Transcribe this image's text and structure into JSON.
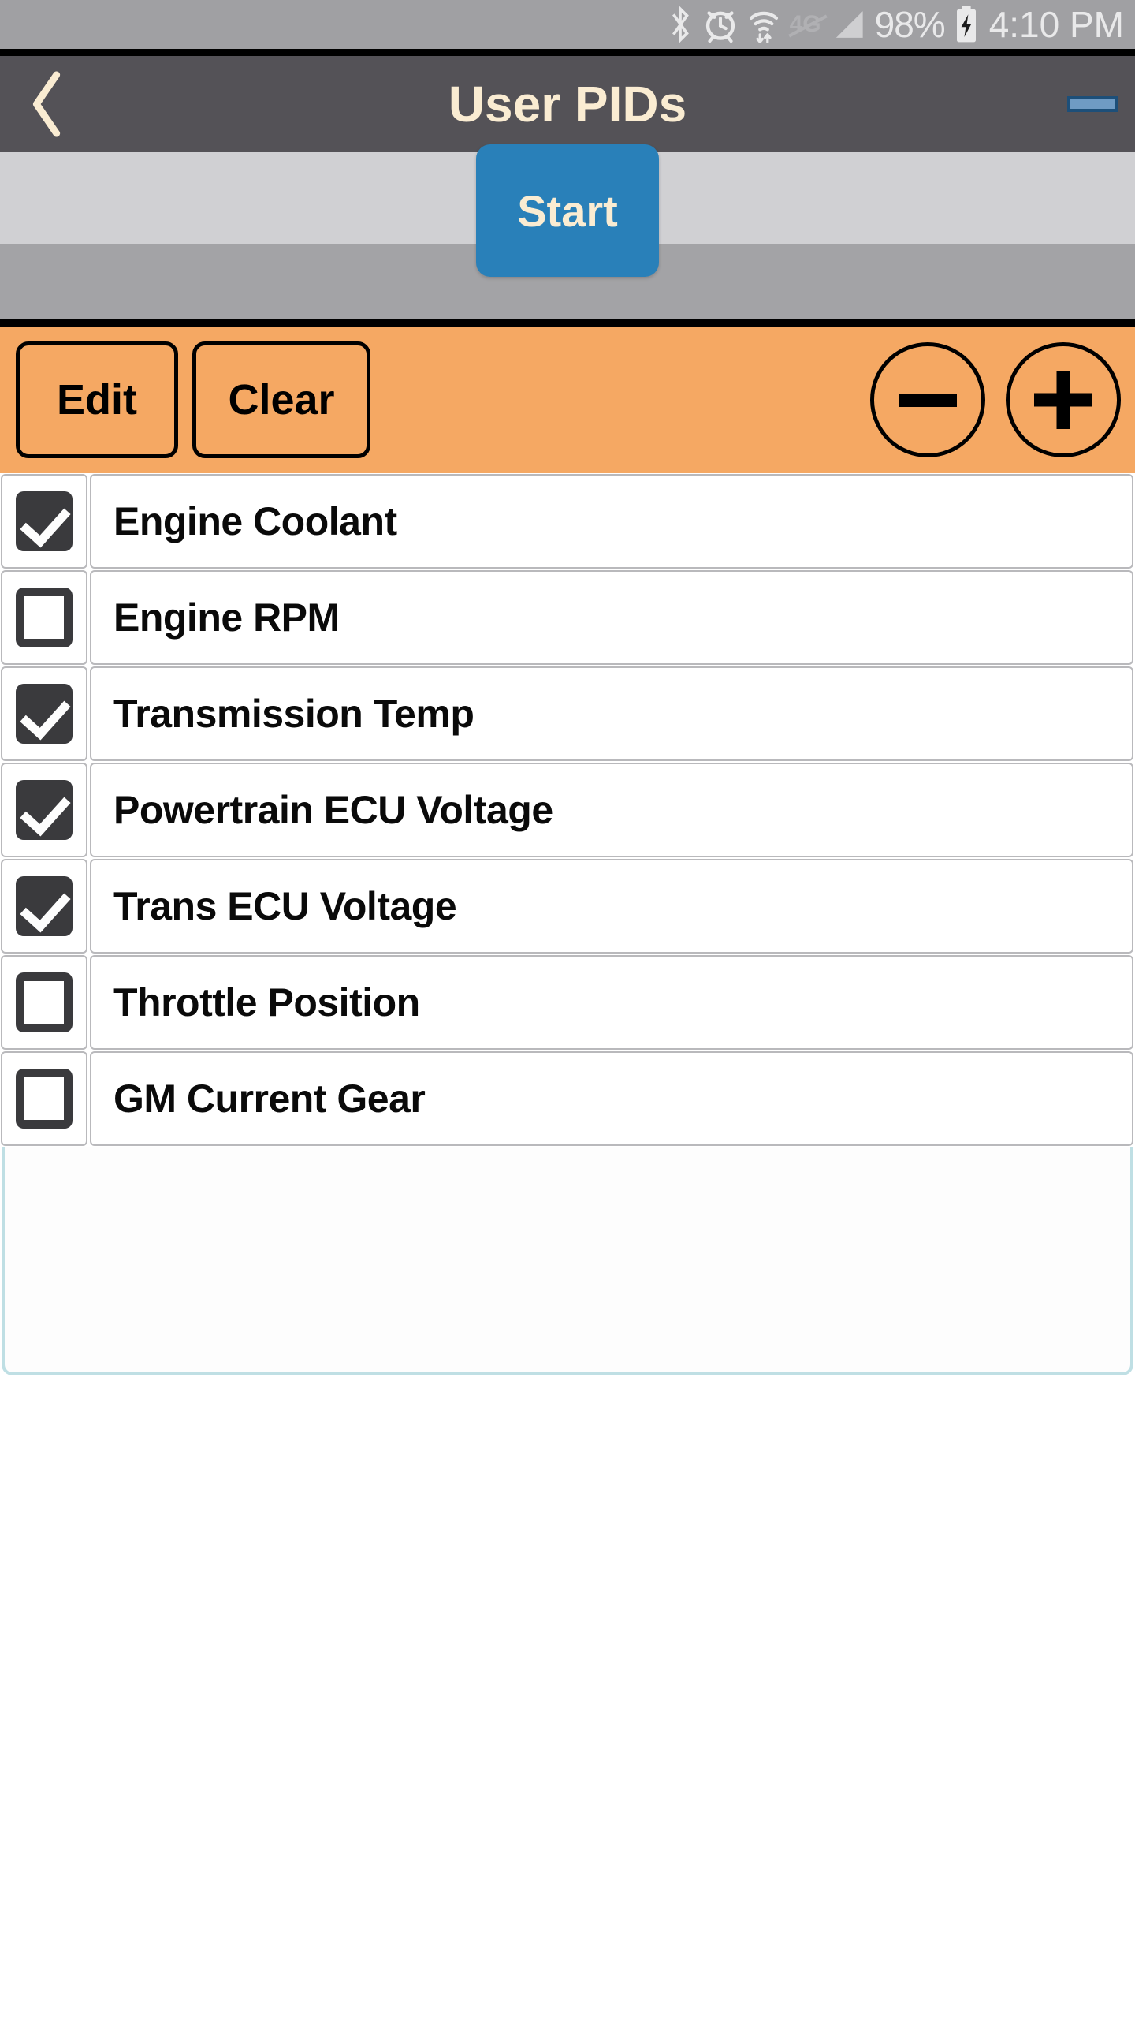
{
  "status_bar": {
    "icons": [
      "bluetooth-icon",
      "alarm-icon",
      "wifi-icon",
      "mobile-data-off-icon",
      "signal-icon"
    ],
    "network_label": "4G",
    "battery_percent": "98%",
    "charging": true,
    "time": "4:10 PM"
  },
  "title_bar": {
    "back_label": "‹",
    "title": "User PIDs",
    "minimize_label": ""
  },
  "start_section": {
    "start_label": "Start"
  },
  "toolbar": {
    "edit_label": "Edit",
    "clear_label": "Clear",
    "minus_label": "−",
    "plus_label": "+"
  },
  "pid_list": {
    "items": [
      {
        "label": "Engine Coolant",
        "checked": true
      },
      {
        "label": "Engine RPM",
        "checked": false
      },
      {
        "label": "Transmission Temp",
        "checked": true
      },
      {
        "label": "Powertrain ECU Voltage",
        "checked": true
      },
      {
        "label": "Trans ECU Voltage",
        "checked": true
      },
      {
        "label": "Throttle Position",
        "checked": false
      },
      {
        "label": "GM Current Gear",
        "checked": false
      }
    ]
  },
  "colors": {
    "status_bar_bg": "#a0a0a3",
    "title_bar_bg": "#545257",
    "title_text": "#faecd2",
    "start_button": "#2980b9",
    "start_section_bg": "#d0d0d3",
    "gray_band": "#a3a3a6",
    "toolbar_orange": "#f5a863",
    "checkbox_dark": "#3a3a3d",
    "row_border": "#b9b9bc",
    "empty_border": "#bfdfe4"
  }
}
